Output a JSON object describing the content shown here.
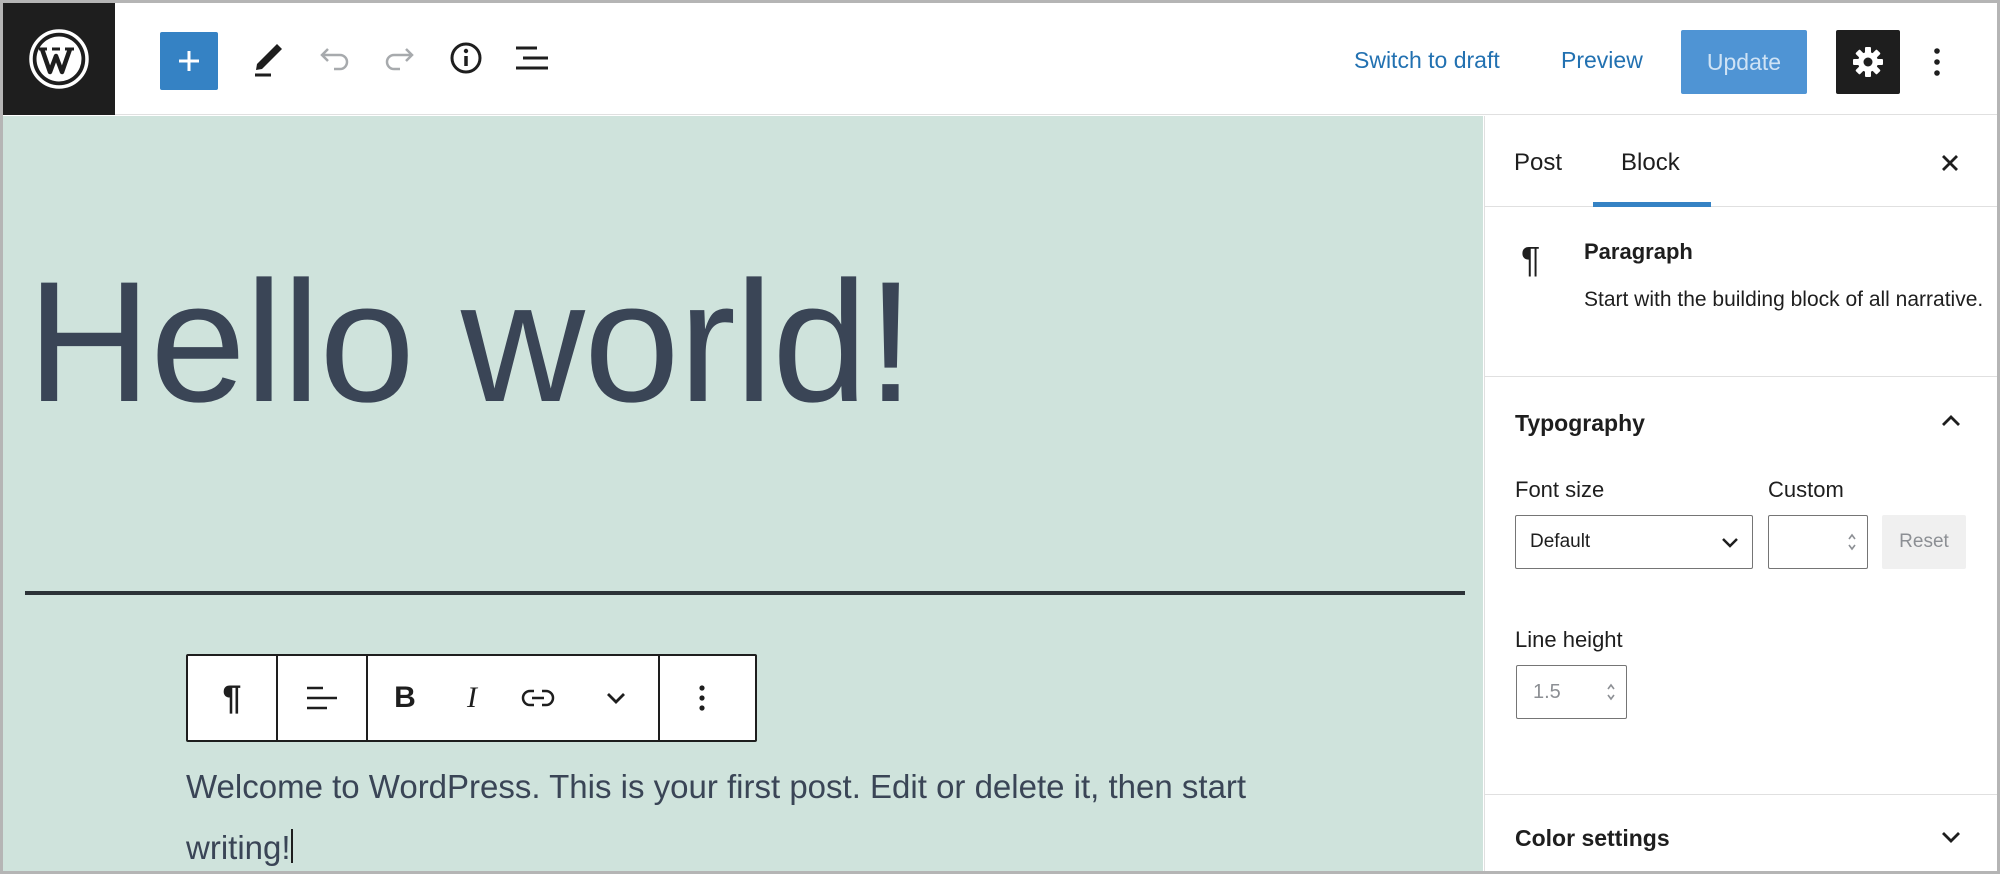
{
  "topbar": {
    "switch_to_draft": "Switch to draft",
    "preview": "Preview",
    "update": "Update",
    "icons": [
      "wordpress-logo-icon",
      "plus-icon",
      "pencil-icon",
      "undo-icon",
      "redo-icon",
      "info-icon",
      "list-view-icon",
      "gear-icon",
      "vertical-ellipsis-icon"
    ]
  },
  "editor": {
    "title": "Hello world!",
    "paragraph": "Welcome to WordPress. This is your first post. Edit or delete it, then start writing!",
    "toolbar": {
      "icons": [
        "pilcrow-icon",
        "align-left-icon",
        "bold-icon",
        "italic-icon",
        "link-icon",
        "chevron-down-icon",
        "vertical-ellipsis-icon"
      ],
      "bold_glyph": "B",
      "italic_glyph": "I",
      "pilcrow_glyph": "¶"
    }
  },
  "sidebar": {
    "tabs": [
      {
        "label": "Post",
        "active": false
      },
      {
        "label": "Block",
        "active": true
      }
    ],
    "block_card": {
      "icon_glyph": "¶",
      "name": "Paragraph",
      "description": "Start with the building block of all narrative."
    },
    "typography": {
      "title": "Typography",
      "font_size_label": "Font size",
      "font_size_value": "Default",
      "custom_label": "Custom",
      "custom_value": "",
      "reset_label": "Reset",
      "line_height_label": "Line height",
      "line_height_value": "1.5"
    },
    "color_settings": {
      "title": "Color settings"
    }
  },
  "colors": {
    "accent": "#3582c4",
    "link": "#2271b1",
    "canvas_bg": "#cfe3dc",
    "dark": "#1e1e1e"
  }
}
